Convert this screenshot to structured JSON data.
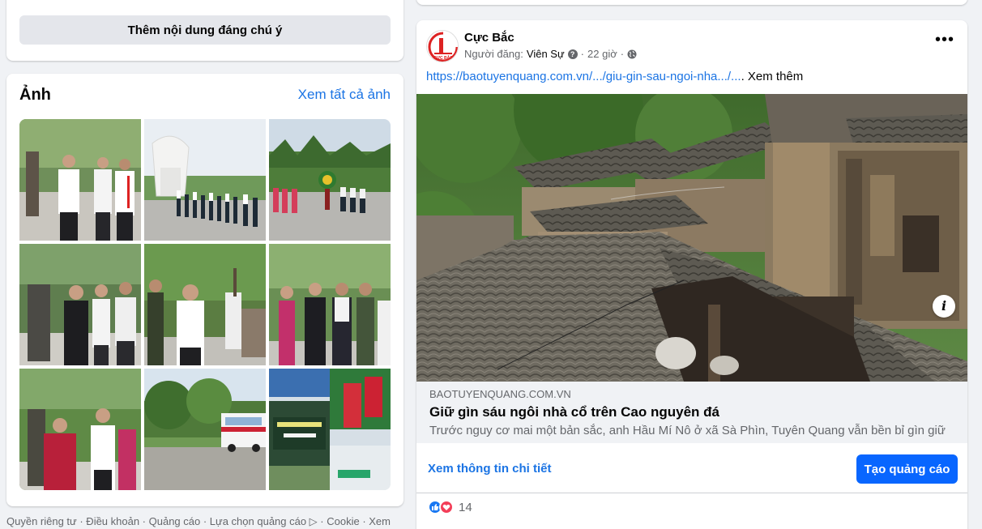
{
  "left": {
    "add_button": "Thêm nội dung đáng chú ý",
    "photos": {
      "title": "Ảnh",
      "see_all": "Xem tất cả ảnh"
    },
    "footer": "Quyền riêng tư · Điều khoản · Quảng cáo · Lựa chọn quảng cáo ▷ · Cookie · Xem"
  },
  "post": {
    "page_name": "Cực Bắc",
    "poster_label": "Người đăng:",
    "poster_name": "Viên Sự",
    "time": "22 giờ",
    "link_text": "https://baotuyenquang.com.vn/.../giu-gin-sau-ngoi-nha.../...",
    "ellipsis": ".",
    "see_more": " Xem thêm",
    "preview": {
      "domain": "BAOTUYENQUANG.COM.VN",
      "title": "Giữ gìn sáu ngôi nhà cổ trên Cao nguyên đá",
      "description": "Trước nguy cơ mai một bản sắc, anh Hầu Mí Nô ở xã Sà Phìn, Tuyên Quang vẫn bền bỉ gìn giữ ..."
    },
    "learn_more": "Xem thông tin chi tiết",
    "create_ad": "Tạo quảng cáo",
    "reaction_count": "14"
  },
  "icons": {
    "more": "more-horizontal-icon",
    "globe": "globe-icon",
    "help": "help-circle-icon",
    "info": "info-icon",
    "like": "like-reaction-icon",
    "love": "love-reaction-icon"
  },
  "colors": {
    "accent": "#1b74e4",
    "primary_button": "#0866ff",
    "background": "#f0f2f5"
  }
}
